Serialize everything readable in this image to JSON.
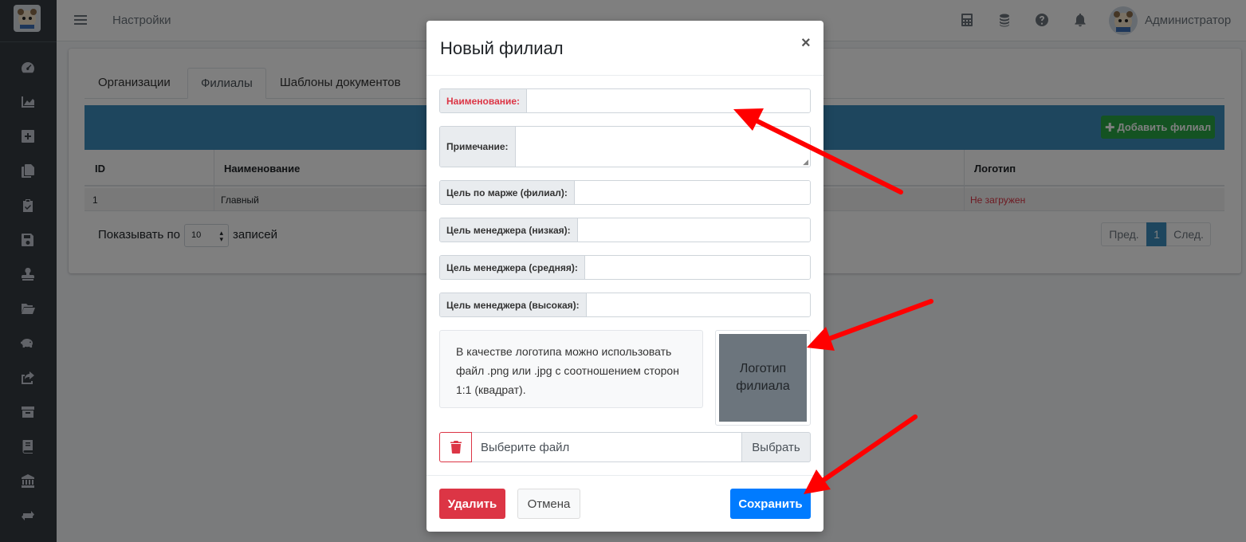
{
  "topbar": {
    "title": "Настройки",
    "user_name": "Администратор"
  },
  "tabs": [
    {
      "label": "Организации"
    },
    {
      "label": "Филиалы",
      "active": true
    },
    {
      "label": "Шаблоны документов"
    }
  ],
  "toolbar": {
    "add_label": "Добавить филиал"
  },
  "table": {
    "headers": [
      "ID",
      "Наименование",
      "Логотип"
    ],
    "rows": [
      {
        "id": "1",
        "name": "Главный",
        "logo": "Не загружен"
      }
    ]
  },
  "pagination": {
    "show_label": "Показывать по",
    "per_page": "10",
    "records_label": "записей",
    "prev": "Пред.",
    "current": "1",
    "next": "След."
  },
  "modal": {
    "title": "Новый филиал",
    "close": "×",
    "fields": {
      "name": {
        "label": "Наименование:",
        "value": ""
      },
      "note": {
        "label": "Примечание:",
        "value": ""
      },
      "margin_target": {
        "label": "Цель по марже (филиал):",
        "value": ""
      },
      "manager_low": {
        "label": "Цель менеджера (низкая):",
        "value": ""
      },
      "manager_mid": {
        "label": "Цель менеджера (средняя):",
        "value": ""
      },
      "manager_high": {
        "label": "Цель менеджера (высокая):",
        "value": ""
      }
    },
    "logo_note": "В качестве логотипа можно использовать файл .png или .jpg с соотношением сторон 1:1 (квадрат).",
    "logo_placeholder_line1": "Логотип",
    "logo_placeholder_line2": "филиала",
    "file_placeholder": "Выберите файл",
    "file_button": "Выбрать",
    "delete_button": "Удалить",
    "cancel_button": "Отмена",
    "save_button": "Сохранить"
  },
  "colors": {
    "sidebar": "#343a40",
    "primary": "#007bff",
    "danger": "#dc3545",
    "success": "#28a745",
    "header_bar": "#3c8dbc",
    "annotation_arrow": "#ff0000"
  }
}
